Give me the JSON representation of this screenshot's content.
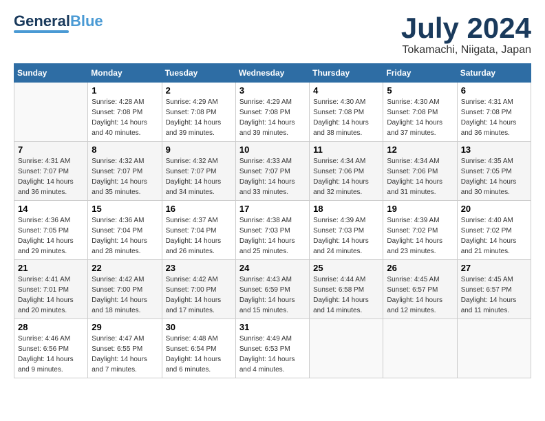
{
  "header": {
    "logo_general": "General",
    "logo_blue": "Blue",
    "month_title": "July 2024",
    "location": "Tokamachi, Niigata, Japan"
  },
  "weekdays": [
    "Sunday",
    "Monday",
    "Tuesday",
    "Wednesday",
    "Thursday",
    "Friday",
    "Saturday"
  ],
  "weeks": [
    [
      {
        "day": "",
        "info": ""
      },
      {
        "day": "1",
        "info": "Sunrise: 4:28 AM\nSunset: 7:08 PM\nDaylight: 14 hours\nand 40 minutes."
      },
      {
        "day": "2",
        "info": "Sunrise: 4:29 AM\nSunset: 7:08 PM\nDaylight: 14 hours\nand 39 minutes."
      },
      {
        "day": "3",
        "info": "Sunrise: 4:29 AM\nSunset: 7:08 PM\nDaylight: 14 hours\nand 39 minutes."
      },
      {
        "day": "4",
        "info": "Sunrise: 4:30 AM\nSunset: 7:08 PM\nDaylight: 14 hours\nand 38 minutes."
      },
      {
        "day": "5",
        "info": "Sunrise: 4:30 AM\nSunset: 7:08 PM\nDaylight: 14 hours\nand 37 minutes."
      },
      {
        "day": "6",
        "info": "Sunrise: 4:31 AM\nSunset: 7:08 PM\nDaylight: 14 hours\nand 36 minutes."
      }
    ],
    [
      {
        "day": "7",
        "info": "Sunrise: 4:31 AM\nSunset: 7:07 PM\nDaylight: 14 hours\nand 36 minutes."
      },
      {
        "day": "8",
        "info": "Sunrise: 4:32 AM\nSunset: 7:07 PM\nDaylight: 14 hours\nand 35 minutes."
      },
      {
        "day": "9",
        "info": "Sunrise: 4:32 AM\nSunset: 7:07 PM\nDaylight: 14 hours\nand 34 minutes."
      },
      {
        "day": "10",
        "info": "Sunrise: 4:33 AM\nSunset: 7:07 PM\nDaylight: 14 hours\nand 33 minutes."
      },
      {
        "day": "11",
        "info": "Sunrise: 4:34 AM\nSunset: 7:06 PM\nDaylight: 14 hours\nand 32 minutes."
      },
      {
        "day": "12",
        "info": "Sunrise: 4:34 AM\nSunset: 7:06 PM\nDaylight: 14 hours\nand 31 minutes."
      },
      {
        "day": "13",
        "info": "Sunrise: 4:35 AM\nSunset: 7:05 PM\nDaylight: 14 hours\nand 30 minutes."
      }
    ],
    [
      {
        "day": "14",
        "info": "Sunrise: 4:36 AM\nSunset: 7:05 PM\nDaylight: 14 hours\nand 29 minutes."
      },
      {
        "day": "15",
        "info": "Sunrise: 4:36 AM\nSunset: 7:04 PM\nDaylight: 14 hours\nand 28 minutes."
      },
      {
        "day": "16",
        "info": "Sunrise: 4:37 AM\nSunset: 7:04 PM\nDaylight: 14 hours\nand 26 minutes."
      },
      {
        "day": "17",
        "info": "Sunrise: 4:38 AM\nSunset: 7:03 PM\nDaylight: 14 hours\nand 25 minutes."
      },
      {
        "day": "18",
        "info": "Sunrise: 4:39 AM\nSunset: 7:03 PM\nDaylight: 14 hours\nand 24 minutes."
      },
      {
        "day": "19",
        "info": "Sunrise: 4:39 AM\nSunset: 7:02 PM\nDaylight: 14 hours\nand 23 minutes."
      },
      {
        "day": "20",
        "info": "Sunrise: 4:40 AM\nSunset: 7:02 PM\nDaylight: 14 hours\nand 21 minutes."
      }
    ],
    [
      {
        "day": "21",
        "info": "Sunrise: 4:41 AM\nSunset: 7:01 PM\nDaylight: 14 hours\nand 20 minutes."
      },
      {
        "day": "22",
        "info": "Sunrise: 4:42 AM\nSunset: 7:00 PM\nDaylight: 14 hours\nand 18 minutes."
      },
      {
        "day": "23",
        "info": "Sunrise: 4:42 AM\nSunset: 7:00 PM\nDaylight: 14 hours\nand 17 minutes."
      },
      {
        "day": "24",
        "info": "Sunrise: 4:43 AM\nSunset: 6:59 PM\nDaylight: 14 hours\nand 15 minutes."
      },
      {
        "day": "25",
        "info": "Sunrise: 4:44 AM\nSunset: 6:58 PM\nDaylight: 14 hours\nand 14 minutes."
      },
      {
        "day": "26",
        "info": "Sunrise: 4:45 AM\nSunset: 6:57 PM\nDaylight: 14 hours\nand 12 minutes."
      },
      {
        "day": "27",
        "info": "Sunrise: 4:45 AM\nSunset: 6:57 PM\nDaylight: 14 hours\nand 11 minutes."
      }
    ],
    [
      {
        "day": "28",
        "info": "Sunrise: 4:46 AM\nSunset: 6:56 PM\nDaylight: 14 hours\nand 9 minutes."
      },
      {
        "day": "29",
        "info": "Sunrise: 4:47 AM\nSunset: 6:55 PM\nDaylight: 14 hours\nand 7 minutes."
      },
      {
        "day": "30",
        "info": "Sunrise: 4:48 AM\nSunset: 6:54 PM\nDaylight: 14 hours\nand 6 minutes."
      },
      {
        "day": "31",
        "info": "Sunrise: 4:49 AM\nSunset: 6:53 PM\nDaylight: 14 hours\nand 4 minutes."
      },
      {
        "day": "",
        "info": ""
      },
      {
        "day": "",
        "info": ""
      },
      {
        "day": "",
        "info": ""
      }
    ]
  ]
}
